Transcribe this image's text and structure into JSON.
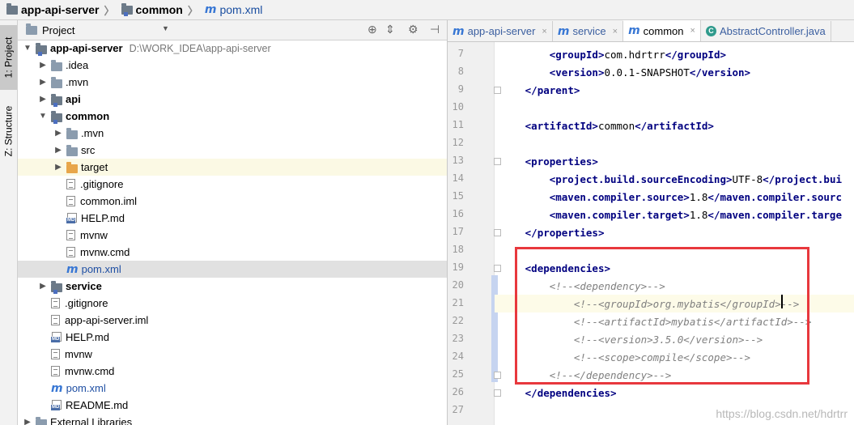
{
  "breadcrumb": {
    "items": [
      {
        "label": "app-api-server",
        "icon": "folder-icon"
      },
      {
        "label": "common",
        "icon": "module-folder-icon"
      },
      {
        "label": "pom.xml",
        "icon": "maven-icon"
      }
    ],
    "separator": "〉"
  },
  "left_strip": {
    "project_tab": "1: Project",
    "structure_tab": "Z: Structure"
  },
  "project_panel": {
    "title": "Project",
    "dropdown_icon": "chevron-down-icon",
    "toolbar_icons": [
      "target-icon",
      "collapse-icon",
      "gear-icon",
      "hide-icon"
    ]
  },
  "tree": [
    {
      "label": "app-api-server",
      "suffix": "D:\\WORK_IDEA\\app-api-server",
      "icon": "module-folder",
      "arrow": "open",
      "bold": true
    },
    {
      "label": ".idea",
      "icon": "folder",
      "arrow": "closed"
    },
    {
      "label": ".mvn",
      "icon": "folder",
      "arrow": "closed"
    },
    {
      "label": "api",
      "icon": "module-folder",
      "arrow": "closed",
      "bold": true
    },
    {
      "label": "common",
      "icon": "module-folder",
      "arrow": "open",
      "bold": true
    },
    {
      "label": ".mvn",
      "icon": "folder",
      "arrow": "closed"
    },
    {
      "label": "src",
      "icon": "folder",
      "arrow": "closed"
    },
    {
      "label": "target",
      "icon": "orange-folder",
      "arrow": "closed"
    },
    {
      "label": ".gitignore",
      "icon": "text-file",
      "arrow": "none"
    },
    {
      "label": "common.iml",
      "icon": "iml-file",
      "arrow": "none"
    },
    {
      "label": "HELP.md",
      "icon": "md-file",
      "arrow": "none"
    },
    {
      "label": "mvnw",
      "icon": "text-file",
      "arrow": "none"
    },
    {
      "label": "mvnw.cmd",
      "icon": "text-file",
      "arrow": "none"
    },
    {
      "label": "pom.xml",
      "icon": "maven",
      "arrow": "none"
    },
    {
      "label": "service",
      "icon": "module-folder",
      "arrow": "closed",
      "bold": true
    },
    {
      "label": ".gitignore",
      "icon": "text-file",
      "arrow": "none"
    },
    {
      "label": "app-api-server.iml",
      "icon": "iml-file",
      "arrow": "none"
    },
    {
      "label": "HELP.md",
      "icon": "md-file",
      "arrow": "none"
    },
    {
      "label": "mvnw",
      "icon": "text-file",
      "arrow": "none"
    },
    {
      "label": "mvnw.cmd",
      "icon": "text-file",
      "arrow": "none"
    },
    {
      "label": "pom.xml",
      "icon": "maven",
      "arrow": "none"
    },
    {
      "label": "README.md",
      "icon": "md-file",
      "arrow": "none"
    },
    {
      "label": "External Libraries",
      "icon": "library",
      "arrow": "closed"
    }
  ],
  "editor_tabs": [
    {
      "label": "app-api-server",
      "icon": "maven-icon",
      "active": false
    },
    {
      "label": "service",
      "icon": "maven-icon",
      "active": false
    },
    {
      "label": "common",
      "icon": "maven-icon",
      "active": true
    },
    {
      "label": "AbstractController.java",
      "icon": "class-icon",
      "active": false
    }
  ],
  "tab_close_glyph": "×",
  "line_numbers": [
    "7",
    "8",
    "9",
    "10",
    "11",
    "12",
    "13",
    "14",
    "15",
    "16",
    "17",
    "18",
    "19",
    "20",
    "21",
    "22",
    "23",
    "24",
    "25",
    "26",
    "27"
  ],
  "code_lines": [
    {
      "indent": "        ",
      "parts": [
        {
          "t": "tag",
          "v": "<groupId>"
        },
        {
          "t": "txt",
          "v": "com.hdrtrr"
        },
        {
          "t": "tag",
          "v": "</groupId>"
        }
      ]
    },
    {
      "indent": "        ",
      "parts": [
        {
          "t": "tag",
          "v": "<version>"
        },
        {
          "t": "txt",
          "v": "0.0.1-SNAPSHOT"
        },
        {
          "t": "tag",
          "v": "</version>"
        }
      ]
    },
    {
      "indent": "    ",
      "parts": [
        {
          "t": "tag",
          "v": "</parent>"
        }
      ]
    },
    {
      "indent": "",
      "parts": []
    },
    {
      "indent": "    ",
      "parts": [
        {
          "t": "tag",
          "v": "<artifactId>"
        },
        {
          "t": "txt",
          "v": "common"
        },
        {
          "t": "tag",
          "v": "</artifactId>"
        }
      ]
    },
    {
      "indent": "",
      "parts": []
    },
    {
      "indent": "    ",
      "parts": [
        {
          "t": "tag",
          "v": "<properties>"
        }
      ]
    },
    {
      "indent": "        ",
      "parts": [
        {
          "t": "tag",
          "v": "<project.build.sourceEncoding>"
        },
        {
          "t": "txt",
          "v": "UTF-8"
        },
        {
          "t": "tag",
          "v": "</project.bui"
        }
      ]
    },
    {
      "indent": "        ",
      "parts": [
        {
          "t": "tag",
          "v": "<maven.compiler.source>"
        },
        {
          "t": "txt",
          "v": "1.8"
        },
        {
          "t": "tag",
          "v": "</maven.compiler.sourc"
        }
      ]
    },
    {
      "indent": "        ",
      "parts": [
        {
          "t": "tag",
          "v": "<maven.compiler.target>"
        },
        {
          "t": "txt",
          "v": "1.8"
        },
        {
          "t": "tag",
          "v": "</maven.compiler.targe"
        }
      ]
    },
    {
      "indent": "    ",
      "parts": [
        {
          "t": "tag",
          "v": "</properties>"
        }
      ]
    },
    {
      "indent": "",
      "parts": []
    },
    {
      "indent": "    ",
      "parts": [
        {
          "t": "tag",
          "v": "<dependencies>"
        }
      ]
    },
    {
      "indent": "        ",
      "parts": [
        {
          "t": "cmt",
          "v": "<!--<dependency>-->"
        }
      ]
    },
    {
      "indent": "            ",
      "parts": [
        {
          "t": "cmt",
          "v": "<!--<groupId>org.mybatis</groupId>-->"
        }
      ],
      "current": true
    },
    {
      "indent": "            ",
      "parts": [
        {
          "t": "cmt",
          "v": "<!--<artifactId>mybatis</artifactId>-->"
        }
      ]
    },
    {
      "indent": "            ",
      "parts": [
        {
          "t": "cmt",
          "v": "<!--<version>3.5.0</version>-->"
        }
      ]
    },
    {
      "indent": "            ",
      "parts": [
        {
          "t": "cmt",
          "v": "<!--<scope>compile</scope>-->"
        }
      ]
    },
    {
      "indent": "        ",
      "parts": [
        {
          "t": "cmt",
          "v": "<!--</dependency>-->"
        }
      ]
    },
    {
      "indent": "    ",
      "parts": [
        {
          "t": "tag",
          "v": "</dependencies>"
        }
      ]
    },
    {
      "indent": "",
      "parts": []
    }
  ],
  "watermark": "https://blog.csdn.net/hdrtrr"
}
